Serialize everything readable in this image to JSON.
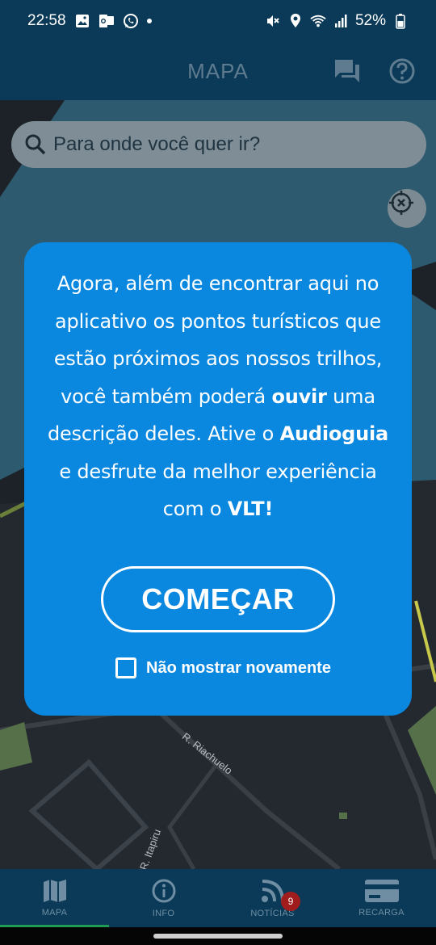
{
  "status_bar": {
    "time": "22:58",
    "battery": "52%",
    "icons_left": [
      "image-icon",
      "outlook-icon",
      "whatsapp-icon",
      "dot-icon"
    ],
    "icons_right": [
      "mute-icon",
      "location-icon",
      "wifi-icon",
      "signal-icon",
      "battery-icon"
    ]
  },
  "header": {
    "title": "MAPA",
    "icons": [
      "chat-icon",
      "help-icon"
    ]
  },
  "map": {
    "search_placeholder": "Para onde você quer ir?",
    "street_labels": [
      "R. Riachuelo",
      "R. Itapiru"
    ]
  },
  "modal": {
    "line1_a": "Agora, além de encontrar aqui no",
    "line2": "aplicativo os pontos turísticos que",
    "line3": "estão próximos aos nossos trilhos,",
    "line4_a": "você também poderá ",
    "line4_b": "ouvir",
    "line4_c": " uma",
    "line5_a": "descrição deles. Ative o ",
    "line5_b": "Audioguia",
    "line6": "e desfrute da melhor experiência",
    "line7_a": "com o ",
    "line7_b": "VLT!",
    "start_button": "COMEÇAR",
    "dont_show_label": "Não mostrar novamente",
    "dont_show_checked": false
  },
  "bottom_nav": {
    "items": [
      {
        "label": "MAPA",
        "icon": "map-icon"
      },
      {
        "label": "INFO",
        "icon": "info-icon"
      },
      {
        "label": "NOTÍCIAS",
        "icon": "rss-icon"
      },
      {
        "label": "RECARGA",
        "icon": "card-icon"
      }
    ],
    "news_badge": "9",
    "active": "MAPA"
  },
  "colors": {
    "modal_bg": "#0a87df",
    "header_bg": "#0a3a57",
    "active_indicator": "#1f9d55",
    "badge": "#a11d1d"
  }
}
